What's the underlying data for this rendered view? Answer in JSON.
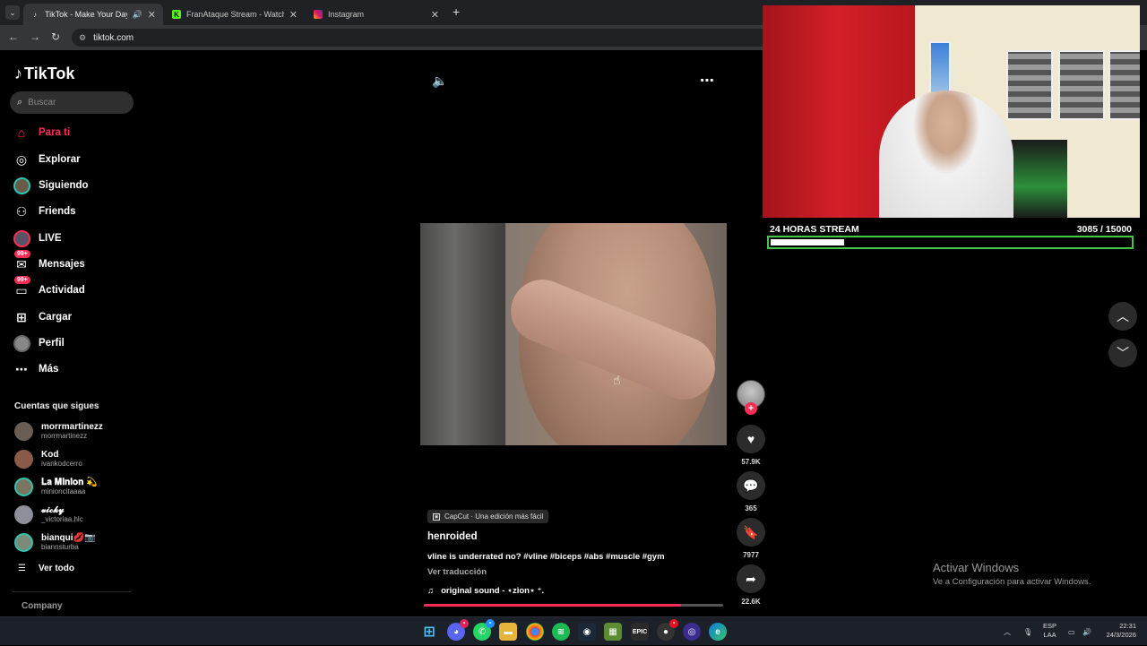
{
  "browser": {
    "tabs": [
      {
        "title": "TikTok - Make Your Day",
        "active": true,
        "favicon": "tiktok-icon"
      },
      {
        "title": "FranAtaque Stream - Watch Liv",
        "active": false,
        "favicon": "kick-icon"
      },
      {
        "title": "Instagram",
        "active": false,
        "favicon": "instagram-icon"
      }
    ],
    "new_tab": "+",
    "url": "tiktok.com"
  },
  "sidebar": {
    "logo": "TikTok",
    "search_placeholder": "Buscar",
    "nav": [
      {
        "label": "Para ti",
        "icon": "home-icon",
        "active": true
      },
      {
        "label": "Explorar",
        "icon": "compass-icon"
      },
      {
        "label": "Siguiendo",
        "icon": "following-avatar-icon"
      },
      {
        "label": "Friends",
        "icon": "friends-icon"
      },
      {
        "label": "LIVE",
        "icon": "live-icon"
      },
      {
        "label": "Mensajes",
        "icon": "messages-icon",
        "badge": "99+"
      },
      {
        "label": "Actividad",
        "icon": "activity-icon",
        "badge": "99+"
      },
      {
        "label": "Cargar",
        "icon": "upload-icon"
      },
      {
        "label": "Perfil",
        "icon": "profile-icon"
      },
      {
        "label": "Más",
        "icon": "more-icon"
      }
    ],
    "following_header": "Cuentas que sigues",
    "following": [
      {
        "name": "morrmartinezz",
        "handle": "morrmartinezz"
      },
      {
        "name": "Kod",
        "handle": "ivankodcerro"
      },
      {
        "name": "𝐋𝐚 𝐌𝐢𝐧𝐢𝐨𝐧 💫",
        "handle": "minioncitaaaa"
      },
      {
        "name": "𝓿𝓲𝓬𝓴𝔂",
        "handle": "_victoriaa.hlc"
      },
      {
        "name": "bianqui💋📷",
        "handle": "biannsturba"
      }
    ],
    "see_all": "Ver todo",
    "company": "Company"
  },
  "video": {
    "capcut": "CapCut · Una edición más fácil",
    "author": "henroided",
    "caption": "vline is underrated no? #vline #biceps #abs #muscle #gym",
    "translate": "Ver traducción",
    "sound": "original sound - ⋆zion⋆ ⁺.",
    "progress": 0.86,
    "likes": "57.9K",
    "comments": "365",
    "saves": "7977",
    "shares": "22.6K"
  },
  "stream_overlay": {
    "label": "24 HORAS STREAM",
    "count": "3085  / 15000",
    "progress_fraction": 0.2057,
    "accent": "#46c646"
  },
  "watermark": {
    "line1": "Activar Windows",
    "line2": "Ve a Configuración para activar Windows."
  },
  "taskbar": {
    "lang1": "ESP",
    "lang2": "LAA",
    "time": "22:31",
    "date": "24/3/2026"
  },
  "colors": {
    "accent": "#fe2c55",
    "chrome_dark": "#202124",
    "taskbar": "#1c2028"
  }
}
